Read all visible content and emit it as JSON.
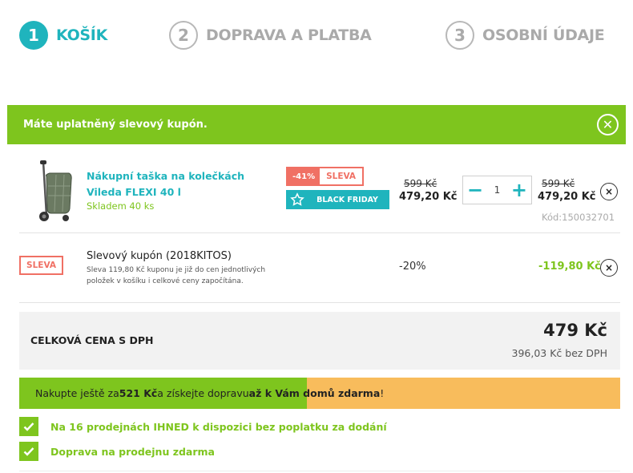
{
  "steps": [
    {
      "num": "1",
      "label": "KOŠÍK",
      "active": true
    },
    {
      "num": "2",
      "label": "DOPRAVA A PLATBA",
      "active": false
    },
    {
      "num": "3",
      "label": "OSOBNÍ ÚDAJE",
      "active": false
    }
  ],
  "banner": {
    "text": "Máte uplatněný slevový kupón.",
    "close_icon": "close-icon"
  },
  "product": {
    "name": "Nákupní taška na kolečkách Vileda FLEXI 40 l",
    "stock": "Skladem 40 ks",
    "discount_pct": "-41%",
    "sale_label": "SLEVA",
    "black_friday_label": "BLACK FRIDAY",
    "unit_old_price": "599 Kč",
    "unit_price": "479,20 Kč",
    "qty_minus": "−",
    "qty": "1",
    "qty_plus": "+",
    "total_old_price": "599 Kč",
    "total_price": "479,20 Kč",
    "remove": "×",
    "code": "Kód:150032701"
  },
  "coupon": {
    "badge": "SLEVA",
    "title": "Slevový kupón (2018KITOS)",
    "desc": "Sleva 119,80 Kč kuponu je již do cen jednotlivých položek v košíku i celkové ceny započítána.",
    "pct": "-20%",
    "value": "-119,80 Kč",
    "remove": "×"
  },
  "total": {
    "label": "CELKOVÁ CENA S DPH",
    "sum": "479 Kč",
    "net": "396,03 Kč bez DPH"
  },
  "free_shipping": {
    "text_1": "Nakupte ještě za ",
    "amount": "521 Kč",
    "text_2": " a získejte dopravu ",
    "bold_2": "až k Vám domů zdarma",
    "text_3": "!",
    "progress": 0.479
  },
  "benefits": [
    "Na 16 prodejnách IHNED k dispozici bez poplatku za dodání",
    "Doprava na prodejnu zdarma"
  ],
  "colors": {
    "accent": "#1fb4bd",
    "green": "#7ec51e",
    "sale": "#f07064",
    "orange": "#f8bc5c"
  }
}
